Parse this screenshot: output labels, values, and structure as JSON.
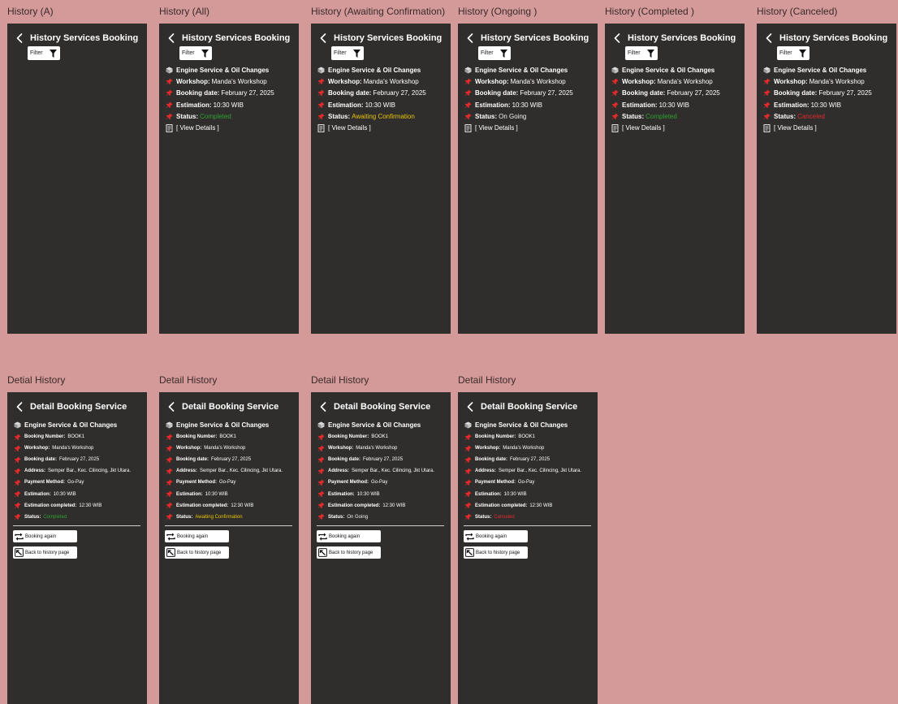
{
  "list_screens": [
    {
      "label": "History (A)",
      "title": "History Services Booking",
      "filter_label": "Filter",
      "has_item": false
    },
    {
      "label": "History (All)",
      "title": "History Services Booking",
      "filter_label": "Filter",
      "has_item": true,
      "item": {
        "service": "Engine Service & Oil Changes",
        "workshop_label": "Workshop:",
        "workshop": "Manda's Workshop",
        "date_label": "Booking date:",
        "date": "February 27, 2025",
        "estimation_label": "Estimation:",
        "estimation": "10:30 WIB",
        "status_label": "Status:",
        "status": "Completed",
        "status_class": "st-completed",
        "view_details": "[ View Details ]"
      }
    },
    {
      "label": "History (Awaiting Confirmation)",
      "title": "History Services Booking",
      "filter_label": "Filter",
      "has_item": true,
      "item": {
        "service": "Engine Service & Oil Changes",
        "workshop_label": "Workshop:",
        "workshop": "Manda's Workshop",
        "date_label": "Booking date:",
        "date": "February 27, 2025",
        "estimation_label": "Estimation:",
        "estimation": "10:30 WIB",
        "status_label": "Status:",
        "status": "Awaiting Confirmation",
        "status_class": "st-awaiting",
        "view_details": "[ View Details ]"
      }
    },
    {
      "label": "History (Ongoing )",
      "title": "History Services Booking",
      "filter_label": "Filter",
      "has_item": true,
      "item": {
        "service": "Engine Service & Oil Changes",
        "workshop_label": "Workshop:",
        "workshop": "Manda's Workshop",
        "date_label": "Booking date:",
        "date": "February 27, 2025",
        "estimation_label": "Estimation:",
        "estimation": "10:30 WIB",
        "status_label": "Status:",
        "status": "On Going",
        "status_class": "st-ongoing",
        "view_details": "[ View Details ]"
      }
    },
    {
      "label": "History (Completed )",
      "title": "History Services Booking",
      "filter_label": "Filter",
      "has_item": true,
      "item": {
        "service": "Engine Service & Oil Changes",
        "workshop_label": "Workshop:",
        "workshop": "Manda's Workshop",
        "date_label": "Booking date:",
        "date": "February 27, 2025",
        "estimation_label": "Estimation:",
        "estimation": "10:30 WIB",
        "status_label": "Status:",
        "status": "Completed",
        "status_class": "st-completed",
        "view_details": "[ View Details ]"
      }
    },
    {
      "label": "History (Canceled)",
      "title": "History Services Booking",
      "filter_label": "Filter",
      "has_item": true,
      "item": {
        "service": "Engine Service & Oil Changes",
        "workshop_label": "Workshop:",
        "workshop": "Manda's Workshop",
        "date_label": "Booking date:",
        "date": "February 27, 2025",
        "estimation_label": "Estimation:",
        "estimation": "10:30 WIB",
        "status_label": "Status:",
        "status": "Canceled",
        "status_class": "st-canceled",
        "view_details": "[ View Details ]"
      }
    }
  ],
  "detail_screens": [
    {
      "label": "Detial History",
      "title": "Detail Booking Service",
      "service": "Engine Service & Oil Changes",
      "fields": [
        {
          "label": "Booking Number:",
          "value": "BOOK1"
        },
        {
          "label": "Workshop:",
          "value": "Manda's Workshop"
        },
        {
          "label": "Booking date:",
          "value": "February 27, 2025"
        },
        {
          "label": "Address:",
          "value": "Semper Bar., Kec. Cilincing, Jkt Utara."
        },
        {
          "label": "Payment Method:",
          "value": "Go-Pay"
        },
        {
          "label": "Estimation:",
          "value": "10:30 WIB"
        },
        {
          "label": "Estimation completed:",
          "value": "12:30 WIB"
        }
      ],
      "status_label": "Status:",
      "status": "Completed",
      "status_class": "st-completed",
      "booking_again": "Booking again",
      "back_history": "Back to history page"
    },
    {
      "label": "Detail History",
      "title": "Detail Booking Service",
      "service": "Engine Service & Oil Changes",
      "fields": [
        {
          "label": "Booking Number:",
          "value": "BOOK1"
        },
        {
          "label": "Workshop:",
          "value": "Manda's Workshop"
        },
        {
          "label": "Booking date:",
          "value": "February 27, 2025"
        },
        {
          "label": "Address:",
          "value": "Semper Bar., Kec. Cilincing, Jkt Utara."
        },
        {
          "label": "Payment Method:",
          "value": "Go-Pay"
        },
        {
          "label": "Estimation:",
          "value": "10:30 WIB"
        },
        {
          "label": "Estimation completed:",
          "value": "12:30 WIB"
        }
      ],
      "status_label": "Status:",
      "status": "Awaiting Confirmation",
      "status_class": "st-awaiting",
      "booking_again": "Booking again",
      "back_history": "Back to history page"
    },
    {
      "label": "Detail History",
      "title": "Detail Booking Service",
      "service": "Engine Service & Oil Changes",
      "fields": [
        {
          "label": "Booking Number:",
          "value": "BOOK1"
        },
        {
          "label": "Workshop:",
          "value": "Manda's Workshop"
        },
        {
          "label": "Booking date:",
          "value": "February 27, 2025"
        },
        {
          "label": "Address:",
          "value": "Semper Bar., Kec. Cilincing, Jkt Utara."
        },
        {
          "label": "Payment Method:",
          "value": "Go-Pay"
        },
        {
          "label": "Estimation:",
          "value": "10:30 WIB"
        },
        {
          "label": "Estimation completed:",
          "value": "12:30 WIB"
        }
      ],
      "status_label": "Status:",
      "status": "On Going",
      "status_class": "st-ongoing",
      "booking_again": "Booking again",
      "back_history": "Back to history page"
    },
    {
      "label": "Detail History",
      "title": "Detail Booking Service",
      "service": "Engine Service & Oil Changes",
      "fields": [
        {
          "label": "Booking Number:",
          "value": "BOOK1"
        },
        {
          "label": "Workshop:",
          "value": "Manda's Workshop"
        },
        {
          "label": "Booking date:",
          "value": "February 27, 2025"
        },
        {
          "label": "Address:",
          "value": "Semper Bar., Kec. Cilincing, Jkt Utara."
        },
        {
          "label": "Payment Method:",
          "value": "Go-Pay"
        },
        {
          "label": "Estimation:",
          "value": "10:30 WIB"
        },
        {
          "label": "Estimation completed:",
          "value": "12:30 WIB"
        }
      ],
      "status_label": "Status:",
      "status": "Canceled",
      "status_class": "st-canceled",
      "booking_again": "Booking again",
      "back_history": "Back to history page"
    }
  ],
  "colors": {
    "canvas": "#d49a9a",
    "screen": "#2f2e2d",
    "pin": "#e12a2a",
    "completed": "#2fa12f",
    "awaiting": "#e8c400",
    "canceled": "#e12a2a"
  },
  "icons": {
    "back": "chevron-left-icon",
    "filter": "funnel-icon",
    "service": "package-icon",
    "field": "pushpin-icon",
    "details": "document-icon",
    "booking_again": "repeat-icon",
    "back_history": "history-icon"
  }
}
